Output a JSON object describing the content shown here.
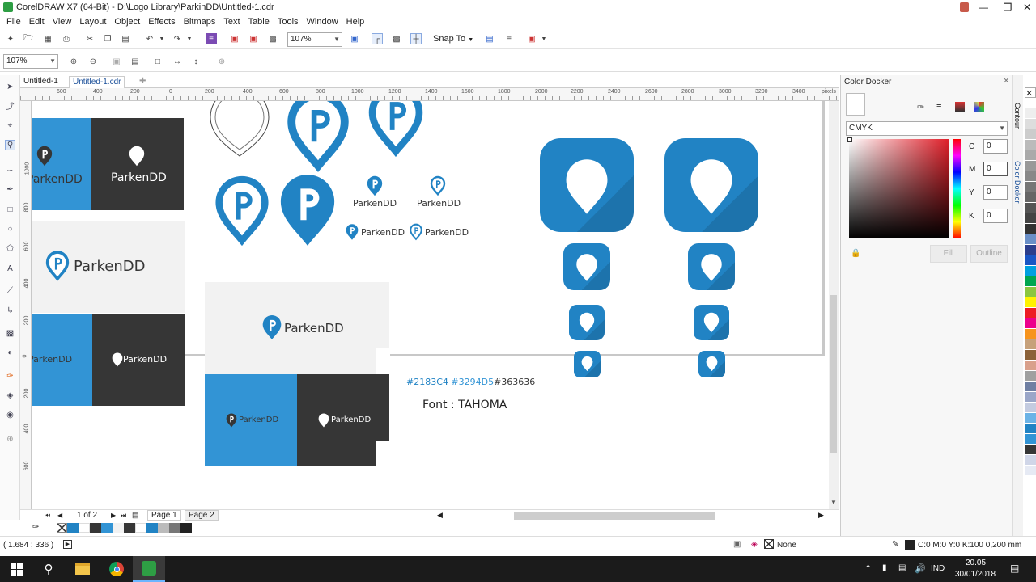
{
  "window": {
    "title": "CorelDRAW X7 (64-Bit) - D:\\Logo Library\\ParkinDD\\Untitled-1.cdr"
  },
  "menu": [
    "File",
    "Edit",
    "View",
    "Layout",
    "Object",
    "Effects",
    "Bitmaps",
    "Text",
    "Table",
    "Tools",
    "Window",
    "Help"
  ],
  "toolbar": {
    "zoom": "107%",
    "snap_to": "Snap To"
  },
  "property_bar": {
    "zoom": "107%"
  },
  "doc_tabs": [
    "Untitled-1",
    "Untitled-1.cdr"
  ],
  "hruler": {
    "labels": [
      "600",
      "400",
      "200",
      "0",
      "200",
      "400",
      "600",
      "800",
      "1000",
      "1200",
      "1400",
      "1600",
      "1800",
      "2000",
      "2200",
      "2400",
      "2600",
      "2800",
      "3000",
      "3200",
      "3400"
    ],
    "unit": "pixels"
  },
  "vruler": {
    "labels": [
      "1000",
      "800",
      "600",
      "400",
      "200",
      "0",
      "200",
      "400",
      "600"
    ]
  },
  "canvas": {
    "brand": "ParkenDD",
    "colors_caption": {
      "c1": "#2183C4",
      "c2": "#3294D5",
      "c3": "#363636"
    },
    "font_caption": "Font : TAHOMA",
    "palette": {
      "blue1": "#2183C4",
      "blue2": "#3294D5",
      "dark": "#363636"
    }
  },
  "page_nav": {
    "counter": "1 of 2",
    "pages": [
      "Page 1",
      "Page 2"
    ]
  },
  "docker": {
    "title": "Color Docker",
    "model": "CMYK",
    "channels": [
      {
        "label": "C",
        "value": "0"
      },
      {
        "label": "M",
        "value": "0"
      },
      {
        "label": "Y",
        "value": "0"
      },
      {
        "label": "K",
        "value": "0"
      }
    ],
    "fill_btn": "Fill",
    "outline_btn": "Outline"
  },
  "side_tabs": [
    "Contour",
    "Color Docker"
  ],
  "status": {
    "coords": "( 1.684 ; 336 )",
    "fill": "None",
    "outline": "C:0 M:0 Y:0 K:100  0,200 mm"
  },
  "taskbar": {
    "lang": "IND",
    "time": "20.05",
    "date": "30/01/2018"
  }
}
